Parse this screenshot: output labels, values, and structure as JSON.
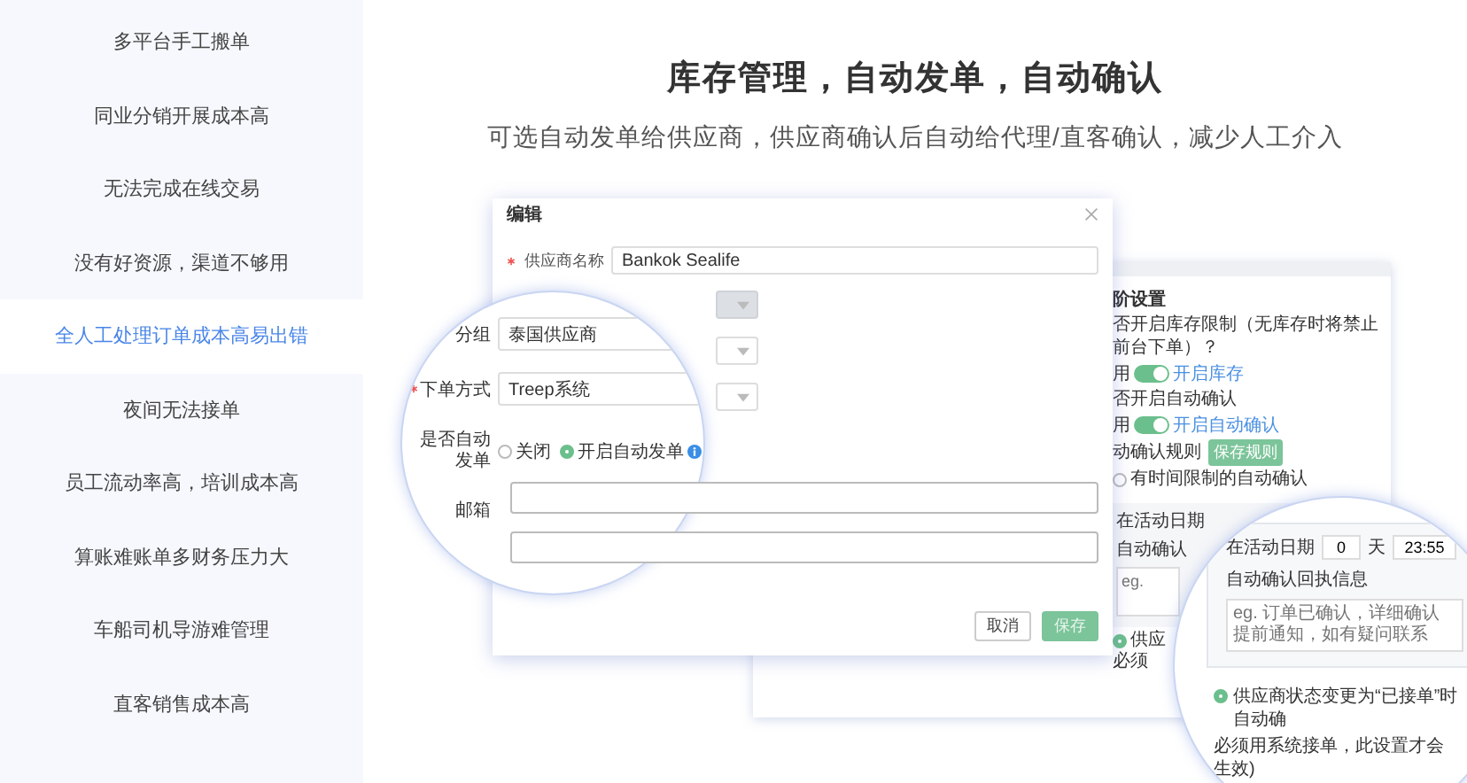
{
  "sidebar": {
    "items": [
      {
        "label": "多平台手工搬单",
        "selected": false
      },
      {
        "label": "同业分销开展成本高",
        "selected": false
      },
      {
        "label": "无法完成在线交易",
        "selected": false
      },
      {
        "label": "没有好资源，渠道不够用",
        "selected": false
      },
      {
        "label": "全人工处理订单成本高易出错",
        "selected": true
      },
      {
        "label": "夜间无法接单",
        "selected": false
      },
      {
        "label": "员工流动率高，培训成本高",
        "selected": false
      },
      {
        "label": "算账难账单多财务压力大",
        "selected": false
      },
      {
        "label": "车船司机导游难管理",
        "selected": false
      },
      {
        "label": "直客销售成本高",
        "selected": false
      }
    ]
  },
  "heading": "库存管理，自动发单，自动确认",
  "subheading": "可选自动发单给供应商，供应商确认后自动给代理/直客确认，减少人工介入",
  "settings_panel": {
    "title": "阶设置",
    "rows": [
      {
        "kind": "question",
        "text": "否开启库存限制（无库存时将禁止前台下单）？"
      },
      {
        "kind": "toggle",
        "label": "用",
        "on": true,
        "status": "开启库存"
      },
      {
        "kind": "question",
        "text": "否开启自动确认"
      },
      {
        "kind": "toggle",
        "label": "用",
        "on": true,
        "status": "开启自动确认"
      },
      {
        "kind": "rule",
        "text": "动确认规则",
        "badge": "保存规则"
      },
      {
        "kind": "radio",
        "text": "有时间限制的自动确认",
        "selected": false
      }
    ],
    "date_label": "在活动日期",
    "reply_label": "自动确认",
    "reply_placeholder": "eg.",
    "option": {
      "text": "供应",
      "note": "必须",
      "selected": true
    }
  },
  "dialog": {
    "title": "编辑",
    "supplier_label": "供应商名称",
    "supplier_required": true,
    "supplier_value": "Bankok Sealife",
    "selects": [
      {
        "disabled": true
      },
      {
        "disabled": false
      },
      {
        "disabled": false
      }
    ],
    "buttons": [
      {
        "label": "取消",
        "kind": "secondary"
      },
      {
        "label": "保存",
        "kind": "primary"
      }
    ]
  },
  "magnifier_left": {
    "group_label": "分组",
    "group_value": "泰国供应商",
    "method_label": "下单方式",
    "method_required": true,
    "method_value": "Treep系统",
    "auto_label": "是否自动发单",
    "auto_options": [
      {
        "label": "关闭",
        "selected": false
      },
      {
        "label": "开启自动发单",
        "selected": true
      }
    ],
    "email_label": "邮箱"
  },
  "magnifier_right": {
    "date_label": "在活动日期",
    "days": "0",
    "days_unit": "天",
    "time": "23:55",
    "reply_label": "自动确认回执信息",
    "reply_placeholder": [
      "eg. 订单已确认，详细确认",
      "提前通知，如有疑问联系"
    ],
    "option": {
      "selected": true,
      "text": "供应商状态变更为“已接单”时自动确",
      "note": "必须用系统接单，此设置才会生效)"
    }
  }
}
